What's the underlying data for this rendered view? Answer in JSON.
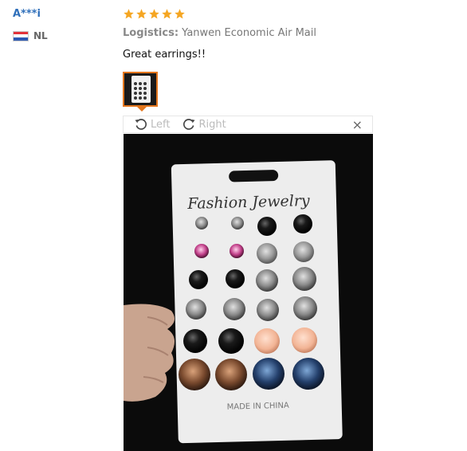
{
  "reviewer": {
    "name": "A***i",
    "country": "NL"
  },
  "review": {
    "rating": 5,
    "logistics_label": "Logistics:",
    "logistics_value": "Yanwen Economic Air Mail",
    "text": "Great earrings!!"
  },
  "viewer": {
    "rotate_left_label": "Left",
    "rotate_right_label": "Right",
    "close_symbol": "×"
  },
  "photo": {
    "card_title": "Fashion Jewelry",
    "card_footer": "MADE IN CHINA"
  },
  "colors": {
    "star": "#f5a623",
    "accent_orange": "#e3761d",
    "name_blue": "#2f6fba"
  },
  "icons": [
    "star-icon",
    "flag-nl-icon",
    "rotate-left-icon",
    "rotate-right-icon",
    "close-icon"
  ]
}
